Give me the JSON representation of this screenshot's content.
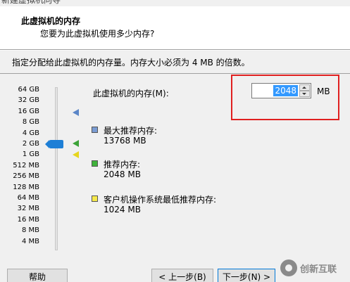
{
  "window": {
    "title": "新建虚拟机向导"
  },
  "header": {
    "title": "此虚拟机的内存",
    "subtitle": "您要为此虚拟机使用多少内存?"
  },
  "instruction": "指定分配给此虚拟机的内存量。内存大小必须为 4 MB 的倍数。",
  "slider": {
    "ticks": [
      "64 GB",
      "32 GB",
      "16 GB",
      "8 GB",
      "4 GB",
      "2 GB",
      "1 GB",
      "512 MB",
      "256 MB",
      "128 MB",
      "64 MB",
      "32 MB",
      "16 MB",
      "8 MB",
      "4 MB"
    ],
    "selected_tick": "2 GB"
  },
  "memory": {
    "label": "此虚拟机的内存(M):",
    "value": "2048",
    "unit": "MB"
  },
  "legend": {
    "max": {
      "title": "最大推荐内存:",
      "value": "13768 MB",
      "color": "#7a9cd3"
    },
    "recommended": {
      "title": "推荐内存:",
      "value": "2048 MB",
      "color": "#3fb23b"
    },
    "min": {
      "title": "客户机操作系统最低推荐内存:",
      "value": "1024 MB",
      "color": "#f5e84a"
    }
  },
  "buttons": {
    "help": "帮助",
    "back": "< 上一步(B)",
    "next": "下一步(N) >"
  },
  "watermark": {
    "text": "创新互联"
  }
}
